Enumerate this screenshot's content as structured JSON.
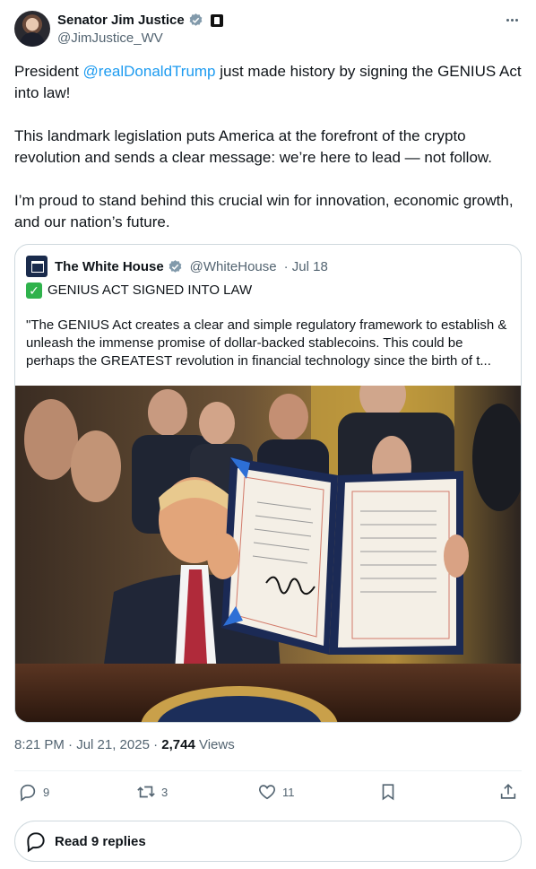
{
  "author": {
    "name": "Senator Jim Justice",
    "handle": "@JimJustice_WV"
  },
  "post": {
    "line1_prefix": "President ",
    "line1_mention": "@realDonaldTrump",
    "line1_suffix": " just made history by signing the GENIUS Act into law!",
    "paragraph2": "This landmark legislation puts America at the forefront of the crypto revolution and sends a clear message: we’re here to lead — not follow.",
    "paragraph3": "I’m proud to stand behind this crucial win for innovation, economic growth, and our nation’s future."
  },
  "quoted": {
    "name": "The White House",
    "handle": "@WhiteHouse",
    "date": "· Jul 18",
    "title": "GENIUS ACT SIGNED INTO LAW",
    "text": "\"The GENIUS Act creates a clear and simple regulatory framework to establish & unleash the immense promise of dollar-backed stablecoins. This could be perhaps the GREATEST revolution in financial technology since the birth of t..."
  },
  "meta": {
    "time": "8:21 PM · Jul 21, 2025 · ",
    "views_count": "2,744",
    "views_label": " Views"
  },
  "actions": {
    "replies": "9",
    "reposts": "3",
    "likes": "11"
  },
  "read_replies_label": "Read 9 replies",
  "colors": {
    "accent": "#1d9bf0",
    "text": "#0f1419",
    "muted": "#536471",
    "border": "#cfd9de"
  }
}
